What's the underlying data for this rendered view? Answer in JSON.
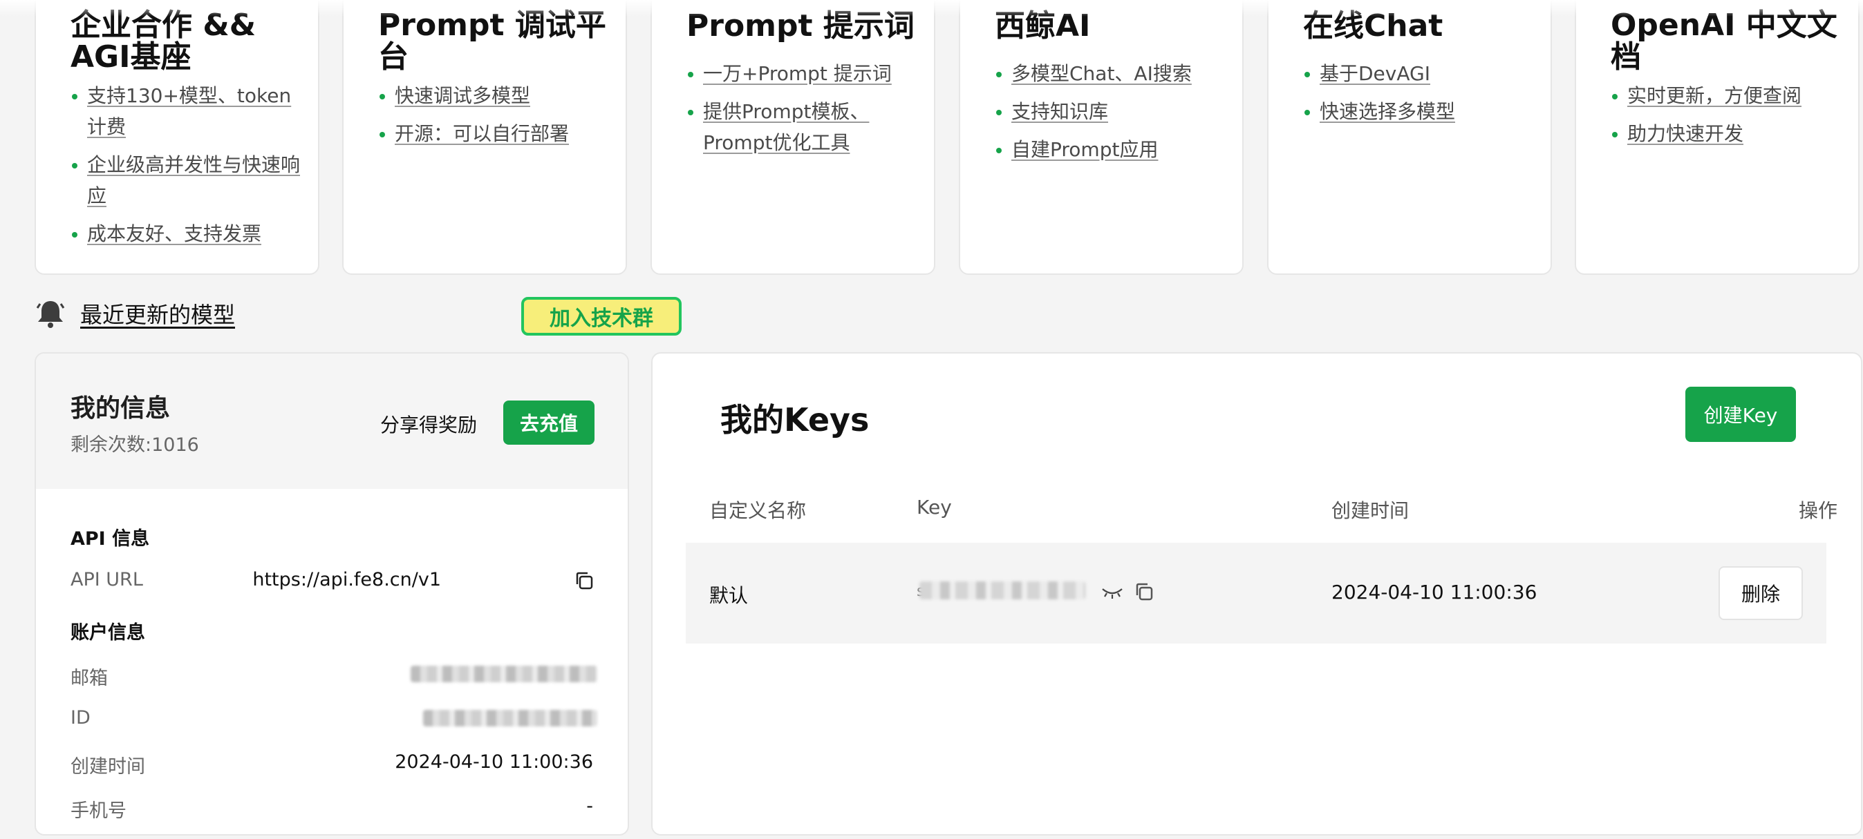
{
  "cards": [
    {
      "title": "企业合作 && AGI基座",
      "items": [
        "支持130+模型、token计费",
        "企业级高并发性与快速响应",
        "成本友好、支持发票"
      ]
    },
    {
      "title": "Prompt 调试平台",
      "items": [
        "快速调试多模型",
        "开源：可以自行部署"
      ]
    },
    {
      "title": "Prompt 提示词",
      "items": [
        "一万+Prompt 提示词",
        "提供Prompt模板、Prompt优化工具"
      ]
    },
    {
      "title": "西鲸AI",
      "items": [
        "多模型Chat、AI搜索",
        "支持知识库",
        "自建Prompt应用"
      ]
    },
    {
      "title": "在线Chat",
      "items": [
        "基于DevAGI",
        "快速选择多模型"
      ]
    },
    {
      "title": "OpenAI 中文文档",
      "items": [
        "实时更新，方便查阅",
        "助力快速开发"
      ]
    }
  ],
  "notice": {
    "link": "最近更新的模型",
    "join_group": "加入技术群"
  },
  "info": {
    "title": "我的信息",
    "remaining": "剩余次数:1016",
    "share": "分享得奖励",
    "recharge": "去充值",
    "api_section": "API 信息",
    "api_url_label": "API URL",
    "api_url": "https://api.fe8.cn/v1",
    "account_section": "账户信息",
    "email_label": "邮箱",
    "id_label": "ID",
    "created_label": "创建时间",
    "created": "2024-04-10 11:00:36",
    "phone_label": "手机号",
    "phone": "-"
  },
  "keys": {
    "title": "我的Keys",
    "create": "创建Key",
    "columns": [
      "自定义名称",
      "Key",
      "创建时间",
      "操作"
    ],
    "rows": [
      {
        "name": "默认",
        "key_prefix": "s",
        "created": "2024-04-10 11:00:36",
        "action": "删除"
      }
    ]
  },
  "colors": {
    "accent": "#16a34a",
    "banner_bg": "#f7ee7a"
  }
}
